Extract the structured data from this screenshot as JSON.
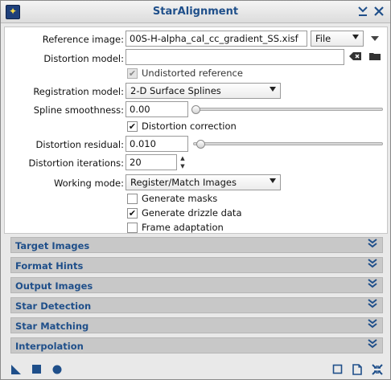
{
  "window": {
    "title": "StarAlignment"
  },
  "titlebar": {
    "pin_glyph": "✕",
    "collapse_glyph": "∨",
    "close_glyph": "✕"
  },
  "reference_image": {
    "label": "Reference image:",
    "value": "00S-H-alpha_cal_cc_gradient_SS.xisf",
    "source_option": "File"
  },
  "distortion_model": {
    "label": "Distortion model:",
    "value": ""
  },
  "undistorted_reference": {
    "label": "Undistorted reference",
    "checked": true,
    "enabled": false
  },
  "registration_model": {
    "label": "Registration model:",
    "value": "2-D Surface Splines"
  },
  "spline_smoothness": {
    "label": "Spline smoothness:",
    "value": "0.00",
    "level": 0.0
  },
  "distortion_correction": {
    "label": "Distortion correction",
    "checked": true
  },
  "distortion_residual": {
    "label": "Distortion residual:",
    "value": "0.010",
    "level": 0.03
  },
  "distortion_iterations": {
    "label": "Distortion iterations:",
    "value": "20"
  },
  "working_mode": {
    "label": "Working mode:",
    "value": "Register/Match Images"
  },
  "generate_masks": {
    "label": "Generate masks",
    "checked": false
  },
  "generate_drizzle": {
    "label": "Generate drizzle data",
    "checked": true
  },
  "frame_adaptation": {
    "label": "Frame adaptation",
    "checked": false
  },
  "sections": [
    {
      "label": "Target Images"
    },
    {
      "label": "Format Hints"
    },
    {
      "label": "Output Images"
    },
    {
      "label": "Star Detection"
    },
    {
      "label": "Star Matching"
    },
    {
      "label": "Interpolation"
    }
  ],
  "glyphs": {
    "check": "✔",
    "arrow_down": "▼",
    "spin_up": "▲",
    "spin_down": "▼",
    "expand": "⯆"
  },
  "colors": {
    "accent": "#1f4f8a",
    "section_bg": "#c8c8c8",
    "window_bg": "#e9e9e9"
  }
}
